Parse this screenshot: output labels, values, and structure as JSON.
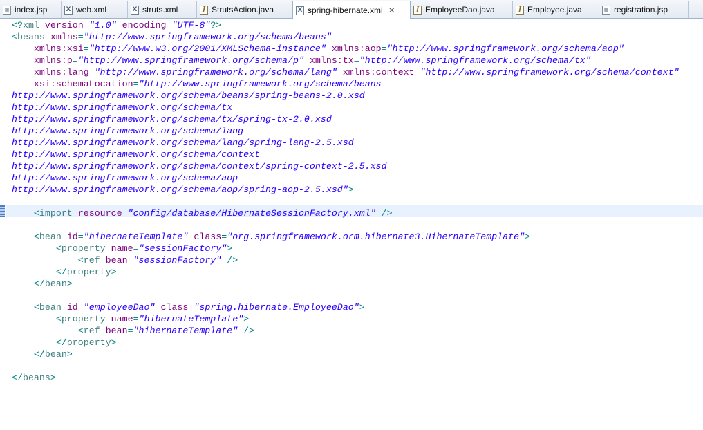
{
  "tabs": [
    {
      "label": "index.jsp",
      "icon": "jsp-file-icon",
      "active": false
    },
    {
      "label": "web.xml",
      "icon": "xml-file-icon",
      "active": false
    },
    {
      "label": "struts.xml",
      "icon": "xml-file-icon",
      "active": false
    },
    {
      "label": "StrutsAction.java",
      "icon": "java-file-icon",
      "active": false
    },
    {
      "label": "spring-hibernate.xml",
      "icon": "xml-file-icon",
      "active": true,
      "close": "✕"
    },
    {
      "label": "EmployeeDao.java",
      "icon": "java-file-icon",
      "active": false
    },
    {
      "label": "Employee.java",
      "icon": "java-file-icon",
      "active": false
    },
    {
      "label": "registration.jsp",
      "icon": "jsp-file-icon",
      "active": false
    }
  ],
  "colors": {
    "tag": "#3f7f7f",
    "attribute": "#7f007f",
    "attribute_value": "#2a00ff",
    "punctuation": "#008080",
    "current_line": "#e8f2fe"
  },
  "code_lines": [
    [
      [
        "p",
        "<?"
      ],
      [
        "t",
        "xml "
      ],
      [
        "a",
        "version"
      ],
      [
        "p",
        "="
      ],
      [
        "v",
        "\"1.0\""
      ],
      [
        "p",
        " "
      ],
      [
        "a",
        "encoding"
      ],
      [
        "p",
        "="
      ],
      [
        "v",
        "\"UTF-8\""
      ],
      [
        "p",
        "?>"
      ]
    ],
    [
      [
        "p",
        "<"
      ],
      [
        "t",
        "beans "
      ],
      [
        "a",
        "xmlns"
      ],
      [
        "p",
        "="
      ],
      [
        "v",
        "\"http://www.springframework.org/schema/beans\""
      ]
    ],
    [
      [
        "p",
        "    "
      ],
      [
        "a",
        "xmlns:xsi"
      ],
      [
        "p",
        "="
      ],
      [
        "v",
        "\"http://www.w3.org/2001/XMLSchema-instance\""
      ],
      [
        "p",
        " "
      ],
      [
        "a",
        "xmlns:aop"
      ],
      [
        "p",
        "="
      ],
      [
        "v",
        "\"http://www.springframework.org/schema/aop\""
      ]
    ],
    [
      [
        "p",
        "    "
      ],
      [
        "a",
        "xmlns:p"
      ],
      [
        "p",
        "="
      ],
      [
        "v",
        "\"http://www.springframework.org/schema/p\""
      ],
      [
        "p",
        " "
      ],
      [
        "a",
        "xmlns:tx"
      ],
      [
        "p",
        "="
      ],
      [
        "v",
        "\"http://www.springframework.org/schema/tx\""
      ]
    ],
    [
      [
        "p",
        "    "
      ],
      [
        "a",
        "xmlns:lang"
      ],
      [
        "p",
        "="
      ],
      [
        "v",
        "\"http://www.springframework.org/schema/lang\""
      ],
      [
        "p",
        " "
      ],
      [
        "a",
        "xmlns:context"
      ],
      [
        "p",
        "="
      ],
      [
        "v",
        "\"http://www.springframework.org/schema/context\""
      ]
    ],
    [
      [
        "p",
        "    "
      ],
      [
        "a",
        "xsi:schemaLocation"
      ],
      [
        "p",
        "="
      ],
      [
        "v",
        "\"http://www.springframework.org/schema/beans"
      ]
    ],
    [
      [
        "v",
        "http://www.springframework.org/schema/beans/spring-beans-2.0.xsd"
      ]
    ],
    [
      [
        "v",
        "http://www.springframework.org/schema/tx"
      ]
    ],
    [
      [
        "v",
        "http://www.springframework.org/schema/tx/spring-tx-2.0.xsd"
      ]
    ],
    [
      [
        "v",
        "http://www.springframework.org/schema/lang"
      ]
    ],
    [
      [
        "v",
        "http://www.springframework.org/schema/lang/spring-lang-2.5.xsd"
      ]
    ],
    [
      [
        "v",
        "http://www.springframework.org/schema/context"
      ]
    ],
    [
      [
        "v",
        "http://www.springframework.org/schema/context/spring-context-2.5.xsd"
      ]
    ],
    [
      [
        "v",
        "http://www.springframework.org/schema/aop"
      ]
    ],
    [
      [
        "v",
        "http://www.springframework.org/schema/aop/spring-aop-2.5.xsd\""
      ],
      [
        "p",
        ">"
      ]
    ],
    [],
    [
      [
        "p",
        "    <"
      ],
      [
        "t",
        "import "
      ],
      [
        "a",
        "resource"
      ],
      [
        "p",
        "="
      ],
      [
        "v",
        "\"config/database/HibernateSessionFactory.xml\""
      ],
      [
        "p",
        " />"
      ]
    ],
    [],
    [
      [
        "p",
        "    <"
      ],
      [
        "t",
        "bean "
      ],
      [
        "a",
        "id"
      ],
      [
        "p",
        "="
      ],
      [
        "v",
        "\"hibernateTemplate\""
      ],
      [
        "p",
        " "
      ],
      [
        "a",
        "class"
      ],
      [
        "p",
        "="
      ],
      [
        "v",
        "\"org.springframework.orm.hibernate3.HibernateTemplate\""
      ],
      [
        "p",
        ">"
      ]
    ],
    [
      [
        "p",
        "        <"
      ],
      [
        "t",
        "property "
      ],
      [
        "a",
        "name"
      ],
      [
        "p",
        "="
      ],
      [
        "v",
        "\"sessionFactory\""
      ],
      [
        "p",
        ">"
      ]
    ],
    [
      [
        "p",
        "            <"
      ],
      [
        "t",
        "ref "
      ],
      [
        "a",
        "bean"
      ],
      [
        "p",
        "="
      ],
      [
        "v",
        "\"sessionFactory\""
      ],
      [
        "p",
        " />"
      ]
    ],
    [
      [
        "p",
        "        </"
      ],
      [
        "t",
        "property"
      ],
      [
        "p",
        ">"
      ]
    ],
    [
      [
        "p",
        "    </"
      ],
      [
        "t",
        "bean"
      ],
      [
        "p",
        ">"
      ]
    ],
    [],
    [
      [
        "p",
        "    <"
      ],
      [
        "t",
        "bean "
      ],
      [
        "a",
        "id"
      ],
      [
        "p",
        "="
      ],
      [
        "v",
        "\"employeeDao\""
      ],
      [
        "p",
        " "
      ],
      [
        "a",
        "class"
      ],
      [
        "p",
        "="
      ],
      [
        "v",
        "\"spring.hibernate.EmployeeDao\""
      ],
      [
        "p",
        ">"
      ]
    ],
    [
      [
        "p",
        "        <"
      ],
      [
        "t",
        "property "
      ],
      [
        "a",
        "name"
      ],
      [
        "p",
        "="
      ],
      [
        "v",
        "\"hibernateTemplate\""
      ],
      [
        "p",
        ">"
      ]
    ],
    [
      [
        "p",
        "            <"
      ],
      [
        "t",
        "ref "
      ],
      [
        "a",
        "bean"
      ],
      [
        "p",
        "="
      ],
      [
        "v",
        "\"hibernateTemplate\""
      ],
      [
        "p",
        " />"
      ]
    ],
    [
      [
        "p",
        "        </"
      ],
      [
        "t",
        "property"
      ],
      [
        "p",
        ">"
      ]
    ],
    [
      [
        "p",
        "    </"
      ],
      [
        "t",
        "bean"
      ],
      [
        "p",
        ">"
      ]
    ],
    [],
    [
      [
        "p",
        "</"
      ],
      [
        "t",
        "beans"
      ],
      [
        "p",
        ">"
      ]
    ]
  ]
}
